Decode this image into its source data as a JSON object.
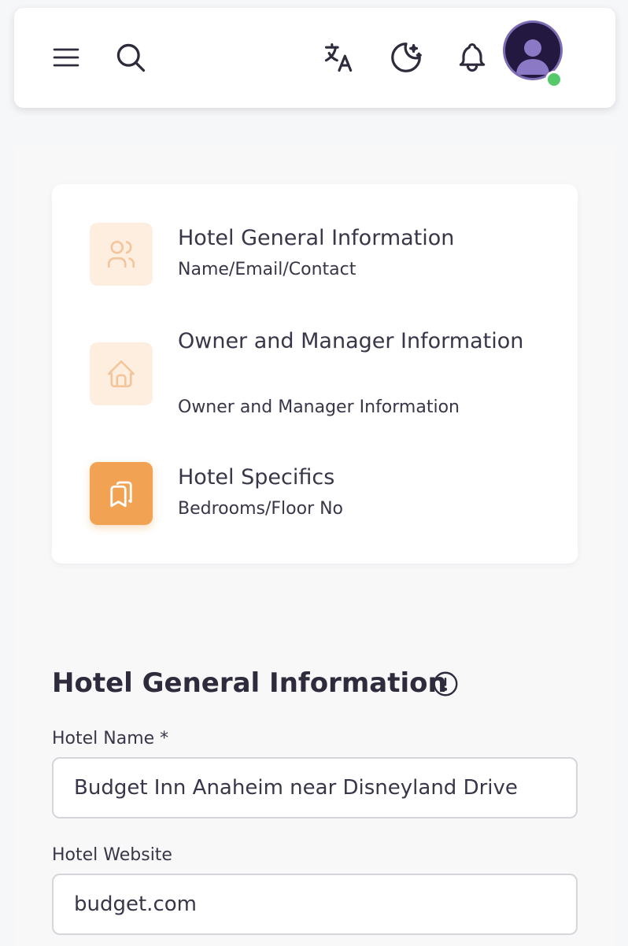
{
  "header": {
    "menu_icon": "menu-icon",
    "search_icon": "search-icon",
    "translate_icon": "translate-icon",
    "theme_icon": "moon-stars-icon",
    "notifications_icon": "bell-icon",
    "avatar_icon": "user-avatar-icon",
    "online_status_color": "#56ca6b"
  },
  "steps": [
    {
      "title": "Hotel General Information",
      "subtitle": "Name/Email/Contact",
      "icon": "users-icon",
      "active": false
    },
    {
      "title": "Owner and Manager Information",
      "subtitle": "Owner and Manager Information",
      "icon": "home-icon",
      "active": false
    },
    {
      "title": "Hotel Specifics",
      "subtitle": "Bedrooms/Floor No",
      "icon": "bookmarks-icon",
      "active": true
    }
  ],
  "form": {
    "section_title": "Hotel General Information",
    "section_info_icon": "info-circle-icon",
    "hotel_name": {
      "label": "Hotel Name *",
      "value": "Budget Inn Anaheim near Disneyland Drive"
    },
    "hotel_website": {
      "label": "Hotel Website",
      "value": "budget.com"
    }
  },
  "colors": {
    "accent": "#f2a253",
    "accent_light": "#fdeee0",
    "text": "#2f2b3d"
  }
}
